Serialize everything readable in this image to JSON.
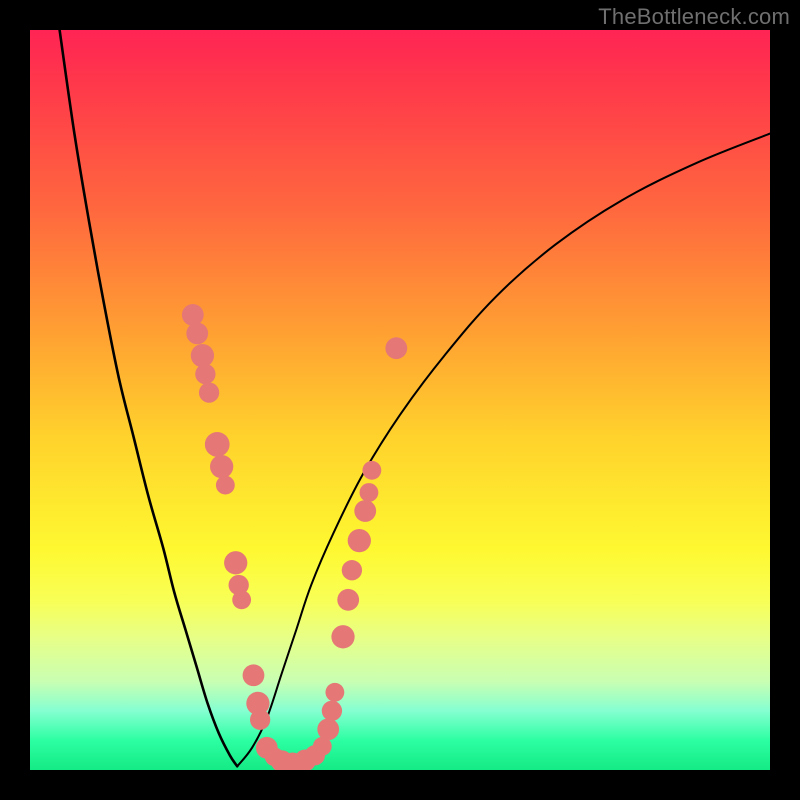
{
  "watermark": "TheBottleneck.com",
  "colors": {
    "background": "#000000",
    "curve": "#000000",
    "marker_fill": "#e57876",
    "marker_stroke": "#d65d5b"
  },
  "chart_data": {
    "type": "line",
    "title": "",
    "xlabel": "",
    "ylabel": "",
    "xlim": [
      0,
      100
    ],
    "ylim": [
      0,
      100
    ],
    "series": [
      {
        "name": "left-curve",
        "x": [
          4,
          6,
          8,
          10,
          12,
          14,
          16,
          18,
          19.5,
          21,
          22.5,
          24,
          25.5,
          27,
          28
        ],
        "y": [
          100,
          86,
          74,
          63,
          53,
          45,
          37,
          30,
          24,
          19,
          14,
          9,
          5,
          2,
          0.5
        ]
      },
      {
        "name": "right-curve",
        "x": [
          28,
          30,
          32,
          34,
          36,
          38,
          41,
          45,
          50,
          56,
          63,
          71,
          80,
          90,
          100
        ],
        "y": [
          0.5,
          3,
          7,
          13,
          19,
          25,
          32,
          40,
          48,
          56,
          64,
          71,
          77,
          82,
          86
        ]
      }
    ],
    "markers": [
      {
        "x": 22.0,
        "y": 61.5,
        "r": 1.0
      },
      {
        "x": 22.6,
        "y": 59.0,
        "r": 1.0
      },
      {
        "x": 23.3,
        "y": 56.0,
        "r": 1.1
      },
      {
        "x": 23.7,
        "y": 53.5,
        "r": 0.9
      },
      {
        "x": 24.2,
        "y": 51.0,
        "r": 0.9
      },
      {
        "x": 25.3,
        "y": 44.0,
        "r": 1.2
      },
      {
        "x": 25.9,
        "y": 41.0,
        "r": 1.1
      },
      {
        "x": 26.4,
        "y": 38.5,
        "r": 0.8
      },
      {
        "x": 27.8,
        "y": 28.0,
        "r": 1.1
      },
      {
        "x": 28.2,
        "y": 25.0,
        "r": 0.9
      },
      {
        "x": 28.6,
        "y": 23.0,
        "r": 0.8
      },
      {
        "x": 30.2,
        "y": 12.8,
        "r": 1.0
      },
      {
        "x": 30.8,
        "y": 9.0,
        "r": 1.1
      },
      {
        "x": 31.1,
        "y": 6.8,
        "r": 0.9
      },
      {
        "x": 32.0,
        "y": 3.0,
        "r": 1.0
      },
      {
        "x": 33.0,
        "y": 1.8,
        "r": 0.8
      },
      {
        "x": 34.0,
        "y": 1.2,
        "r": 1.0
      },
      {
        "x": 35.5,
        "y": 1.0,
        "r": 0.9
      },
      {
        "x": 37.2,
        "y": 1.3,
        "r": 1.0
      },
      {
        "x": 38.5,
        "y": 2.0,
        "r": 0.9
      },
      {
        "x": 39.5,
        "y": 3.2,
        "r": 0.8
      },
      {
        "x": 40.3,
        "y": 5.5,
        "r": 1.0
      },
      {
        "x": 40.8,
        "y": 8.0,
        "r": 0.9
      },
      {
        "x": 41.2,
        "y": 10.5,
        "r": 0.8
      },
      {
        "x": 42.3,
        "y": 18.0,
        "r": 1.1
      },
      {
        "x": 43.0,
        "y": 23.0,
        "r": 1.0
      },
      {
        "x": 43.5,
        "y": 27.0,
        "r": 0.9
      },
      {
        "x": 44.5,
        "y": 31.0,
        "r": 1.1
      },
      {
        "x": 45.3,
        "y": 35.0,
        "r": 1.0
      },
      {
        "x": 45.8,
        "y": 37.5,
        "r": 0.8
      },
      {
        "x": 46.2,
        "y": 40.5,
        "r": 0.8
      },
      {
        "x": 49.5,
        "y": 57.0,
        "r": 1.0
      }
    ]
  }
}
